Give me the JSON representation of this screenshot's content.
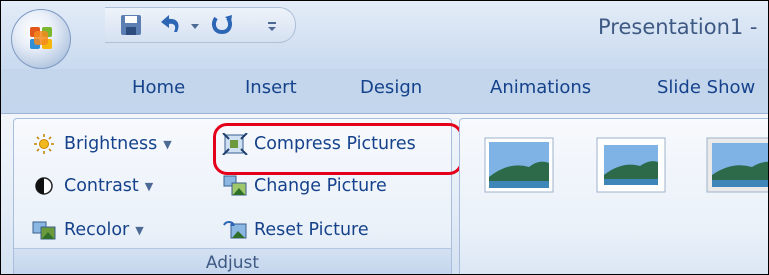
{
  "app": {
    "title": "Presentation1 -"
  },
  "quick_access": {
    "items": [
      {
        "icon": "save-icon"
      },
      {
        "icon": "undo-icon"
      },
      {
        "icon": "undo-dropdown-icon"
      },
      {
        "icon": "repeat-icon"
      },
      {
        "icon": "customize-qat-icon"
      }
    ]
  },
  "tabs": [
    "Home",
    "Insert",
    "Design",
    "Animations",
    "Slide Show"
  ],
  "ribbon": {
    "adjust_group": {
      "label": "Adjust",
      "commands": [
        {
          "label": "Brightness",
          "icon": "sun-icon",
          "has_dropdown": true
        },
        {
          "label": "Contrast",
          "icon": "contrast-icon",
          "has_dropdown": true
        },
        {
          "label": "Recolor",
          "icon": "recolor-icon",
          "has_dropdown": true
        },
        {
          "label": "Compress Pictures",
          "icon": "compress-pictures-icon",
          "has_dropdown": false,
          "highlighted": true
        },
        {
          "label": "Change Picture",
          "icon": "change-picture-icon",
          "has_dropdown": false
        },
        {
          "label": "Reset Picture",
          "icon": "reset-picture-icon",
          "has_dropdown": false
        }
      ]
    },
    "picture_styles": {
      "thumbnail_count": 3
    }
  },
  "colors": {
    "tab_text": "#15428b",
    "title_text": "#3e5a84",
    "highlight": "#e4001b",
    "ribbon_bg": "#e3ecf7"
  }
}
